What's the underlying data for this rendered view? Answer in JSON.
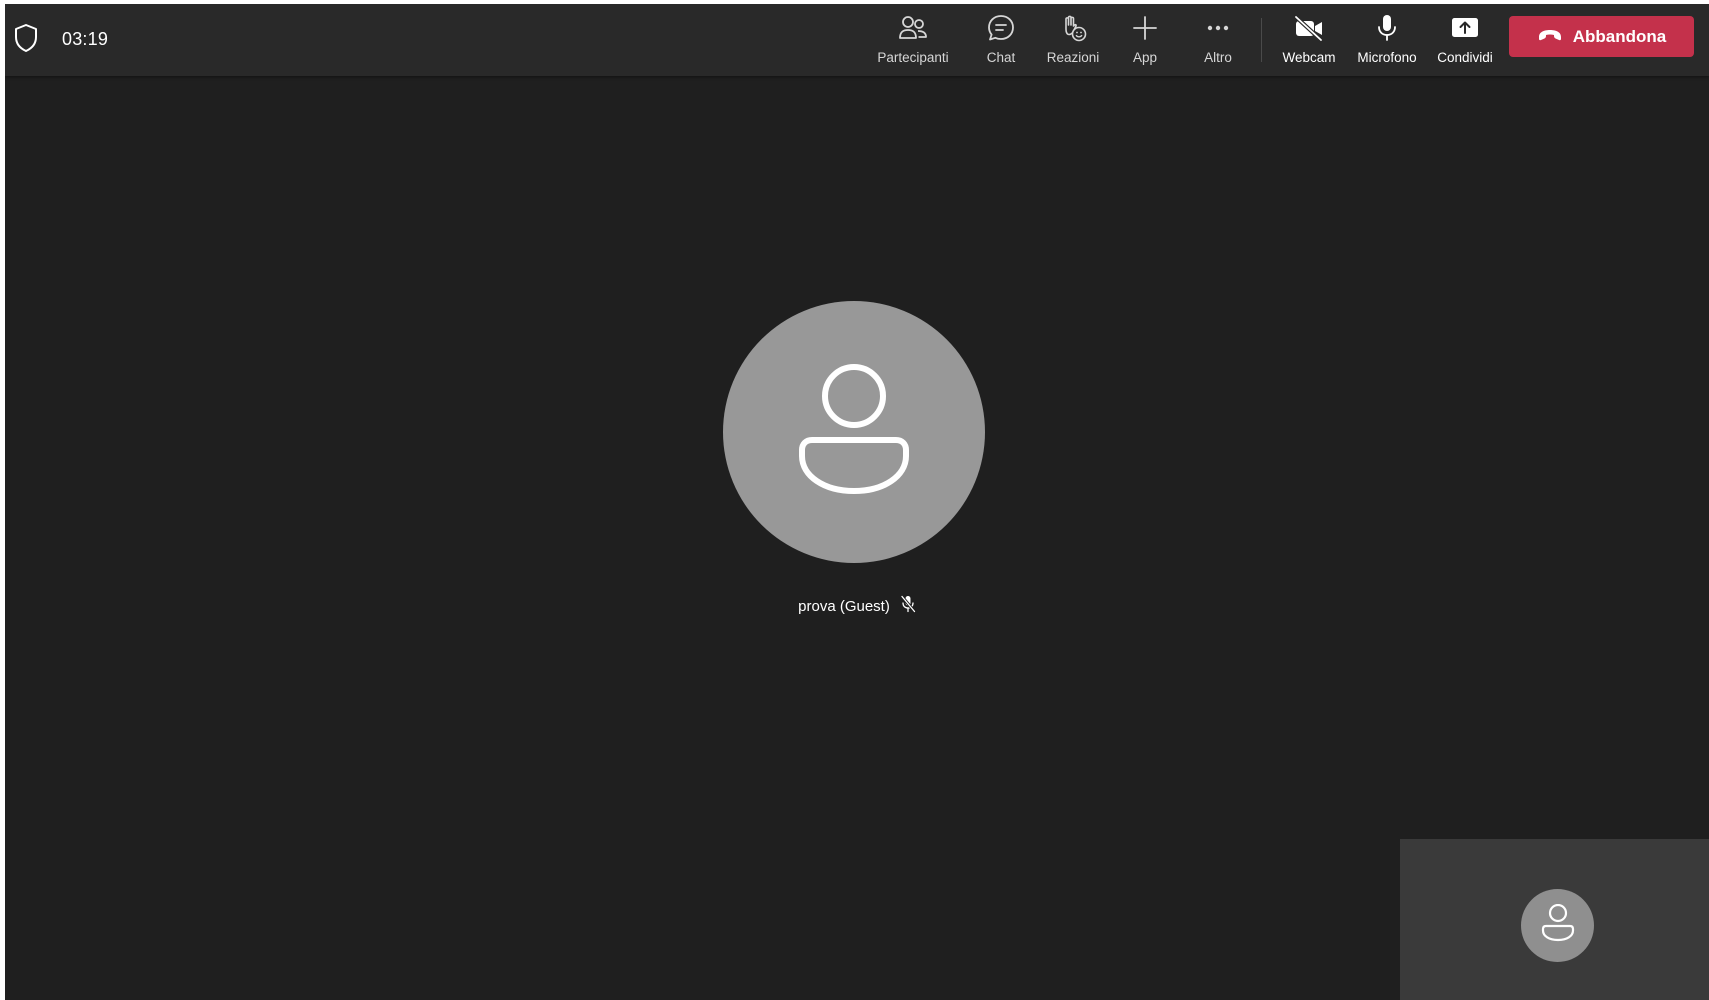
{
  "call": {
    "timer": "03:19"
  },
  "toolbar": {
    "participants_label": "Partecipanti",
    "chat_label": "Chat",
    "reactions_label": "Reazioni",
    "apps_label": "App",
    "more_label": "Altro",
    "camera_label": "Webcam",
    "mic_label": "Microfono",
    "share_label": "Condividi",
    "leave_label": "Abbandona"
  },
  "main_participant": {
    "name": "prova (Guest)",
    "muted": true
  },
  "colors": {
    "background": "#1f1f1f",
    "topbar": "#292929",
    "leave_button": "#c4314b",
    "avatar": "#989898",
    "self_tile": "#3a3a3a"
  },
  "icons": [
    "shield-icon",
    "participants-icon",
    "chat-icon",
    "reactions-icon",
    "add-icon",
    "more-icon",
    "camera-off-icon",
    "microphone-icon",
    "share-icon",
    "hang-up-icon",
    "person-icon",
    "mic-muted-icon"
  ]
}
